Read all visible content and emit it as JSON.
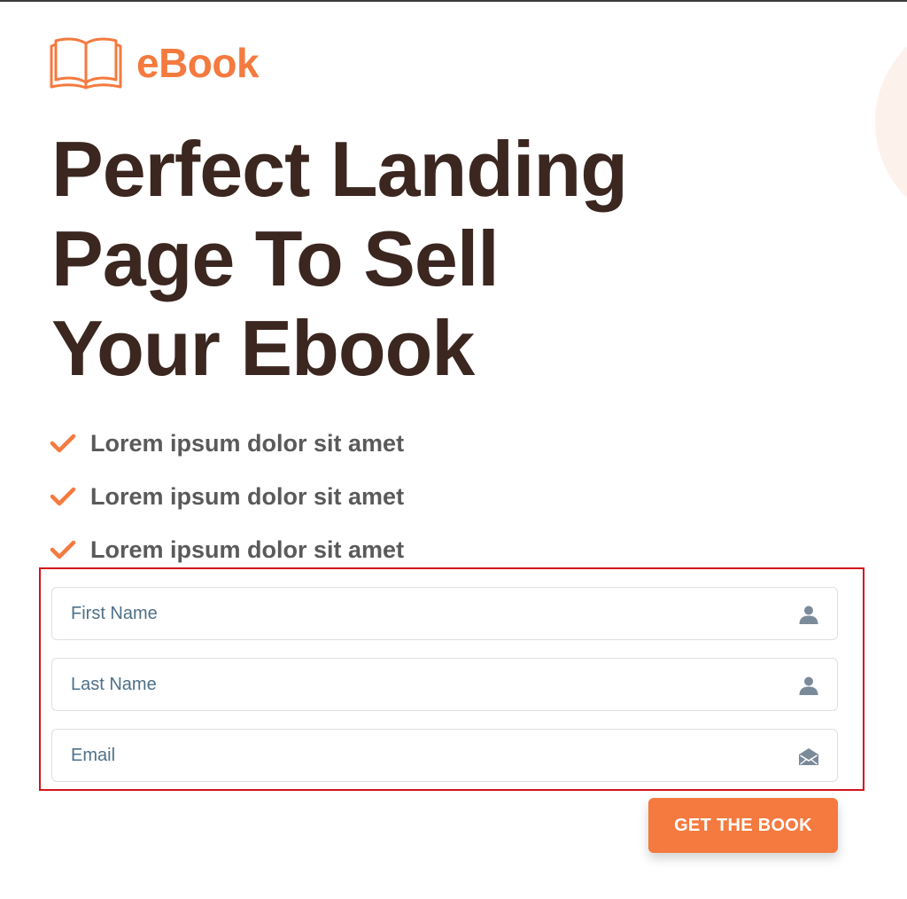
{
  "brand": {
    "name": "eBook",
    "icon": "open-book-icon",
    "accent_color": "#f47a3f"
  },
  "hero": {
    "headline_lines": [
      "Perfect Landing",
      "Page To Sell",
      "Your Ebook"
    ],
    "text_color": "#3b2620"
  },
  "features": [
    {
      "icon": "check-icon",
      "label": "Lorem ipsum dolor sit amet"
    },
    {
      "icon": "check-icon",
      "label": "Lorem ipsum dolor sit amet"
    },
    {
      "icon": "check-icon",
      "label": "Lorem ipsum dolor sit amet"
    }
  ],
  "form": {
    "highlight_color": "#d3141b",
    "fields": [
      {
        "placeholder": "First Name",
        "value": "",
        "icon": "user-icon"
      },
      {
        "placeholder": "Last Name",
        "value": "",
        "icon": "user-icon"
      },
      {
        "placeholder": "Email",
        "value": "",
        "icon": "envelope-icon"
      }
    ],
    "submit_label": "GET THE BOOK"
  }
}
